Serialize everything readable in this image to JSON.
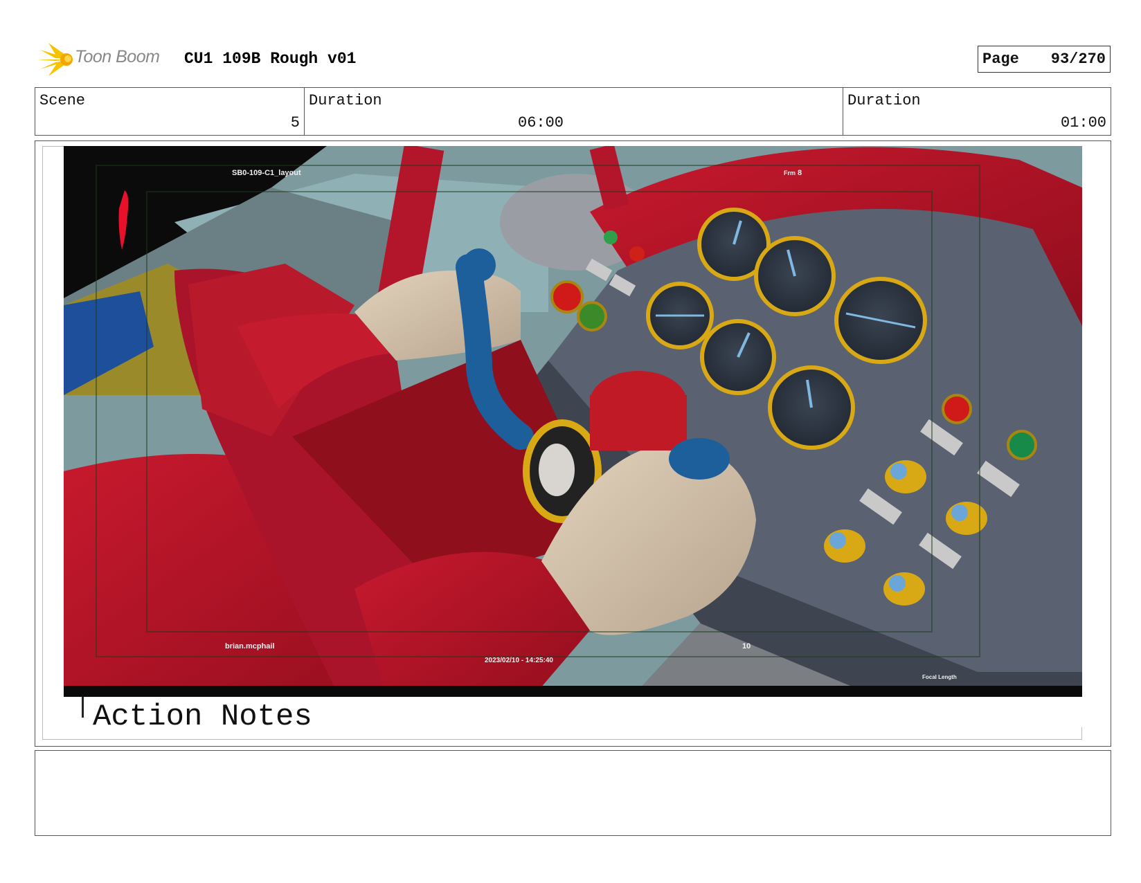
{
  "header": {
    "logo_text": "Toon Boom",
    "title": "CU1 109B Rough v01",
    "page_label": "Page",
    "page_value": "93/270"
  },
  "info": {
    "scene_label": "Scene",
    "scene_value": "5",
    "duration1_label": "Duration",
    "duration1_value": "06:00",
    "duration2_label": "Duration",
    "duration2_value": "01:00"
  },
  "frame": {
    "overlay_top_left": "SB0-109-C1_layout",
    "overlay_top_right_label": "Frm",
    "overlay_top_right_value": "8",
    "overlay_bottom_left": "brian.mcphail",
    "overlay_bottom_center": "2023/02/10 - 14:25:40",
    "overlay_bottom_right_number": "10",
    "overlay_bottom_right_label": "Focal Length",
    "bleed_text": "Action Notes"
  },
  "colors": {
    "jacket_red": "#c0182c",
    "panel_gray": "#5a6272",
    "gauge_gold": "#d9a915",
    "stick_blue": "#1d5f9a",
    "glove": "#d6c4ad"
  }
}
